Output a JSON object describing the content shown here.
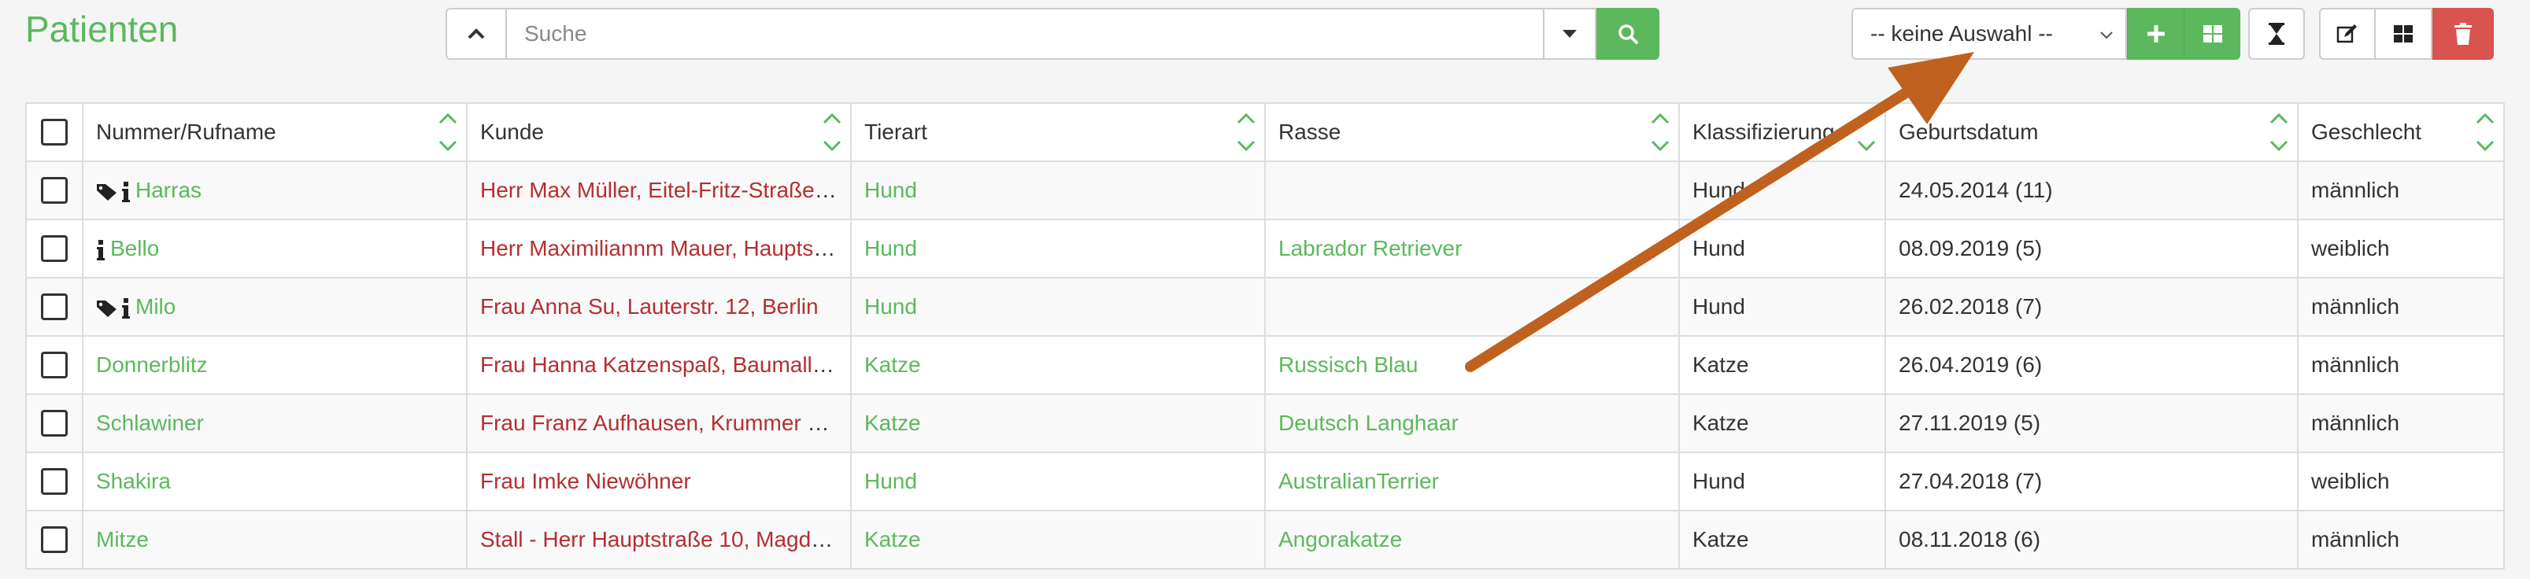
{
  "header": {
    "title": "Patienten",
    "search": {
      "placeholder": "Suche",
      "value": ""
    },
    "view_select": {
      "value": "-- keine Auswahl --"
    }
  },
  "colors": {
    "accent_green": "#5cb85c",
    "danger_red": "#d9534f",
    "customer_red": "#b52e31",
    "annotation_arrow": "#c0611f"
  },
  "table": {
    "columns": [
      "Nummer/Rufname",
      "Kunde",
      "Tierart",
      "Rasse",
      "Klassifizierung",
      "Geburtsdatum",
      "Geschlecht"
    ],
    "rows": [
      {
        "name": "Harras",
        "icons": [
          "tag-icon",
          "info-icon"
        ],
        "kunde": "Herr Max Müller, Eitel-Fritz-Straße …",
        "tierart": "Hund",
        "rasse": "",
        "klass": "Hund",
        "geburt": "24.05.2014 (11)",
        "geschlecht": "männlich"
      },
      {
        "name": "Bello",
        "icons": [
          "info-icon"
        ],
        "kunde": "Herr Maximiliannm Mauer, Hauptst…",
        "tierart": "Hund",
        "rasse": "Labrador Retriever",
        "klass": "Hund",
        "geburt": "08.09.2019 (5)",
        "geschlecht": "weiblich"
      },
      {
        "name": "Milo",
        "icons": [
          "tag-icon",
          "info-icon"
        ],
        "kunde": "Frau Anna Su, Lauterstr. 12, Berlin",
        "tierart": "Hund",
        "rasse": "",
        "klass": "Hund",
        "geburt": "26.02.2018 (7)",
        "geschlecht": "männlich"
      },
      {
        "name": "Donnerblitz",
        "icons": [],
        "kunde": "Frau Hanna Katzenspaß, Baumalle…",
        "tierart": "Katze",
        "rasse": "Russisch Blau",
        "klass": "Katze",
        "geburt": "26.04.2019 (6)",
        "geschlecht": "männlich"
      },
      {
        "name": "Schlawiner",
        "icons": [],
        "kunde": "Frau Franz Aufhausen, Krummer W…",
        "tierart": "Katze",
        "rasse": "Deutsch Langhaar",
        "klass": "Katze",
        "geburt": "27.11.2019 (5)",
        "geschlecht": "männlich"
      },
      {
        "name": "Shakira",
        "icons": [],
        "kunde": "Frau Imke Niewöhner",
        "tierart": "Hund",
        "rasse": "AustralianTerrier",
        "klass": "Hund",
        "geburt": "27.04.2018 (7)",
        "geschlecht": "weiblich"
      },
      {
        "name": "Mitze",
        "icons": [],
        "kunde": "Stall - Herr Hauptstraße 10, Magde…",
        "tierart": "Katze",
        "rasse": "Angorakatze",
        "klass": "Katze",
        "geburt": "08.11.2018 (6)",
        "geschlecht": "männlich"
      }
    ]
  }
}
